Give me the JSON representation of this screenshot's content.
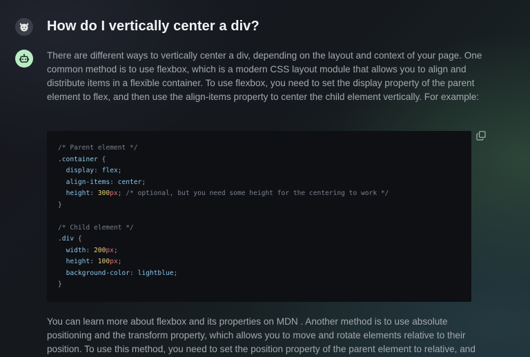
{
  "conversation": {
    "question": "How do I vertically center a div?",
    "answer_paragraphs": [
      "There are different ways to vertically center a div, depending on the layout and context of your page. One common method is to use flexbox, which is a modern CSS layout module that allows you to align and distribute items in a flexible container. To use flexbox, you need to set the display property of the parent element to flex, and then use the align-items property to center the child element vertically. For example:",
      "You can learn more about flexbox and its properties on MDN . Another method is to use absolute positioning and the transform property, which allows you to move and rotate elements relative to their position. To use this method, you need to set the position property of the parent element to relative, and"
    ],
    "code": {
      "comment_parent": "/* Parent element */",
      "selector_container": ".container",
      "brace_open": " {",
      "brace_close": "}",
      "colon": ": ",
      "semicolon": ";",
      "prop_display": "display",
      "val_flex": "flex",
      "prop_align_items": "align-items",
      "val_center": "center",
      "prop_height": "height",
      "num_300": "300",
      "unit_px": "px",
      "comment_optional": "/* optional, but you need some height for the centering to work */",
      "comment_child": "/* Child element */",
      "selector_div": ".div",
      "prop_width": "width",
      "num_200": "200",
      "num_100": "100",
      "prop_background_color": "background-color",
      "val_lightblue": "lightblue"
    }
  },
  "icons": {
    "user_avatar": "user-avatar-icon",
    "assistant_avatar": "assistant-avatar-icon",
    "copy": "copy-icon"
  },
  "colors": {
    "assistant_avatar_bg": "#b9ecc4",
    "code_bg": "#0e1014",
    "unit_red": "#e2707a",
    "number_yellow": "#e6cf7a",
    "keyword_blue": "#8cc4e6"
  }
}
